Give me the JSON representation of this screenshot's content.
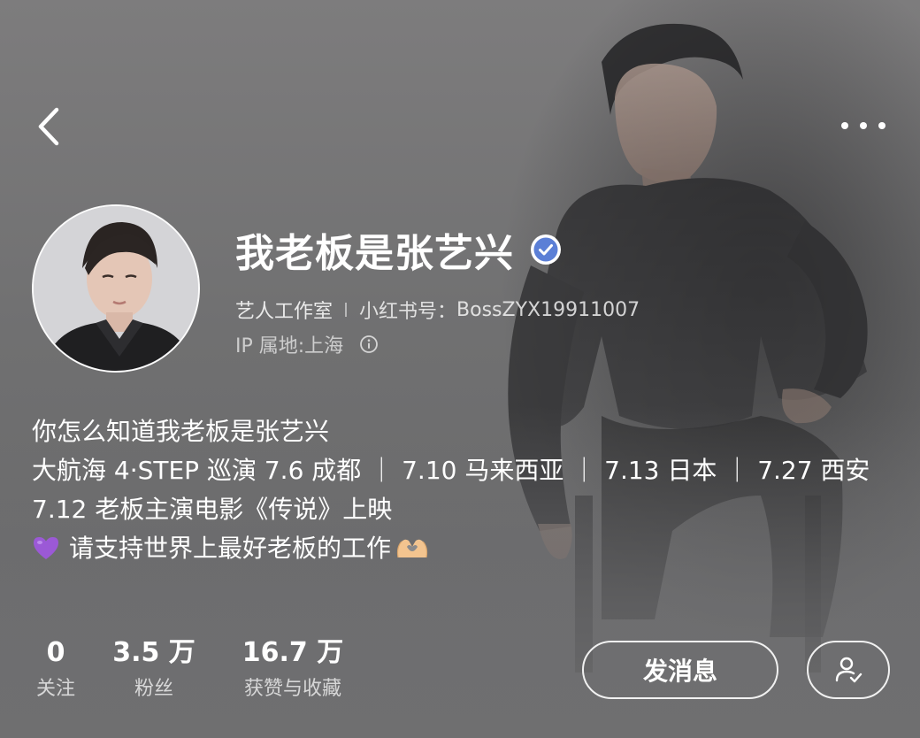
{
  "profile": {
    "nickname": "我老板是张艺兴",
    "tag": "艺人工作室",
    "account_id_label": "小红书号：",
    "account_id": "BossZYX19911007",
    "ip_label": "IP 属地: ",
    "ip_location": "上海"
  },
  "bio": {
    "line1": "你怎么知道我老板是张艺兴",
    "line2": "大航海 4·STEP 巡演 7.6 成都 ｜ 7.10 马来西亚 ｜ 7.13 日本 ｜ 7.27 西安",
    "line3": "7.12 老板主演电影《传说》上映",
    "line4": "请支持世界上最好老板的工作"
  },
  "stats": {
    "following": {
      "value": "0",
      "label": "关注"
    },
    "fans": {
      "value": "3.5 万",
      "label": "粉丝"
    },
    "likes": {
      "value": "16.7 万",
      "label": "获赞与收藏"
    }
  },
  "actions": {
    "message_label": "发消息"
  },
  "icons": {
    "back": "chevron-left-icon",
    "more": "more-dots-icon",
    "verified": "verified-badge-icon",
    "info": "info-icon",
    "heart": "purple-heart-emoji",
    "hands": "heart-hands-emoji",
    "followed": "user-check-icon"
  },
  "colors": {
    "verified_badge": "#5b7fd6",
    "heart": "#9b59d6"
  }
}
